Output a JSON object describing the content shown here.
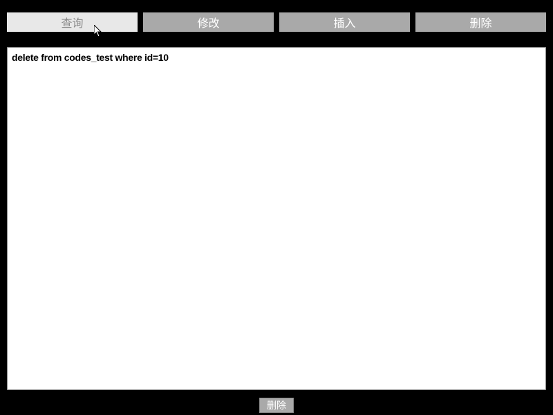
{
  "tabs": {
    "query": "查询",
    "modify": "修改",
    "insert": "插入",
    "delete": "删除"
  },
  "active_tab": "query",
  "content": {
    "sql": "delete from codes_test where id=10"
  },
  "bottom_button": {
    "label": "删除"
  }
}
